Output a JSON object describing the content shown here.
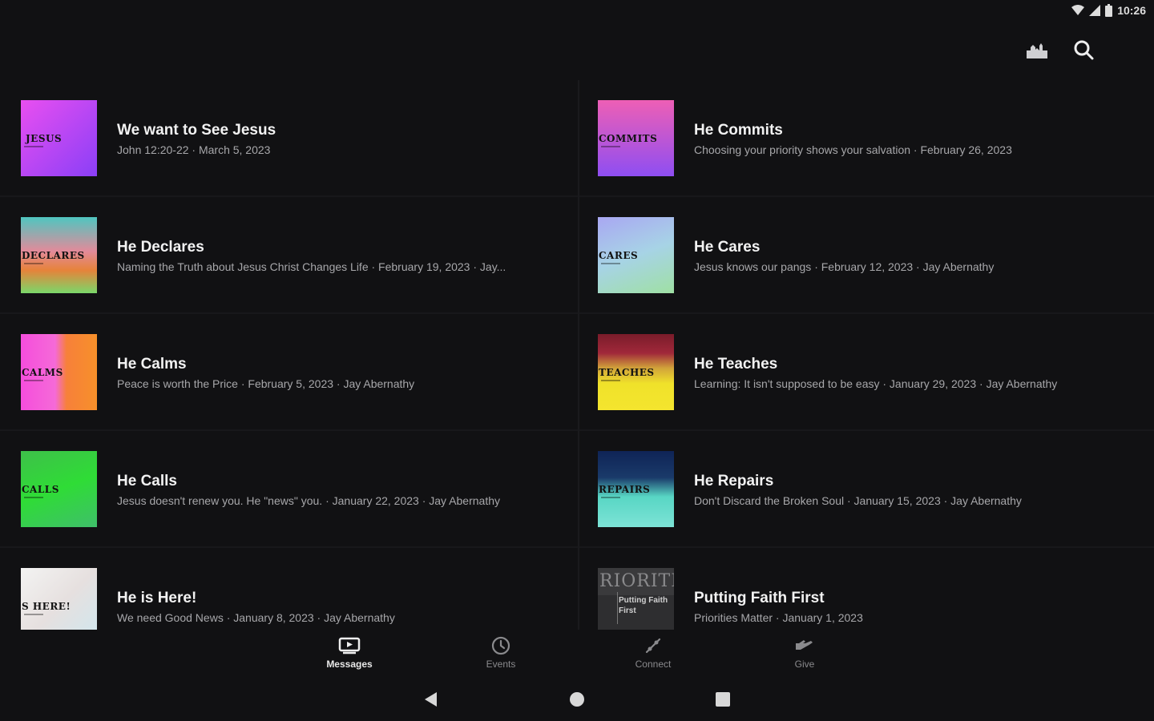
{
  "status": {
    "time": "10:26"
  },
  "toolbar": {
    "icons": [
      "church-icon",
      "search-icon"
    ]
  },
  "messages": [
    {
      "word": "JESUS",
      "title": "We want to See Jesus",
      "subtitle": "John 12:20-22 · March 5, 2023"
    },
    {
      "word": "COMMITS",
      "title": "He Commits",
      "subtitle": "Choosing your priority shows your salvation · February 26, 2023"
    },
    {
      "word": "DECLARES",
      "title": "He Declares",
      "subtitle": "Naming the Truth about Jesus Christ Changes Life · February 19, 2023 · Jay..."
    },
    {
      "word": "CARES",
      "title": "He Cares",
      "subtitle": "Jesus knows our pangs · February 12, 2023 · Jay Abernathy"
    },
    {
      "word": "CALMS",
      "title": "He Calms",
      "subtitle": "Peace is worth the Price · February 5, 2023 · Jay Abernathy"
    },
    {
      "word": "TEACHES",
      "title": "He Teaches",
      "subtitle": "Learning: It isn't supposed to be easy · January 29, 2023 · Jay Abernathy"
    },
    {
      "word": "CALLS",
      "title": "He Calls",
      "subtitle": "Jesus doesn't renew you. He \"news\" you. · January 22, 2023 · Jay Abernathy"
    },
    {
      "word": "REPAIRS",
      "title": "He Repairs",
      "subtitle": "Don't Discard the Broken Soul · January 15, 2023 · Jay Abernathy"
    },
    {
      "word": "S HERE!",
      "title": "He is Here!",
      "subtitle": "We need Good News · January 8, 2023 · Jay Abernathy"
    },
    {
      "word": "RIORITIE",
      "thumb_caption": "Putting Faith First",
      "title": "Putting Faith First",
      "subtitle": "Priorities Matter · January 1, 2023"
    }
  ],
  "colors": {
    "background": "#111113",
    "thumb_jesus": "#a448f5",
    "thumb_commits": "#c25be8",
    "thumb_declares": "#d97a6e",
    "thumb_cares": "#9ec7d6",
    "thumb_calms": "#f56ad8",
    "thumb_teaches": "#f0e22a",
    "thumb_calls": "#34d23a",
    "thumb_repairs": "#5fd8c8",
    "thumb_here": "#e9e6e4",
    "thumb_faith": "#3b3b3b"
  },
  "bottom_nav": [
    {
      "label": "Messages",
      "icon": "tv-icon",
      "active": true
    },
    {
      "label": "Events",
      "icon": "clock-icon",
      "active": false
    },
    {
      "label": "Connect",
      "icon": "connect-icon",
      "active": false
    },
    {
      "label": "Give",
      "icon": "give-hand-icon",
      "active": false
    }
  ]
}
